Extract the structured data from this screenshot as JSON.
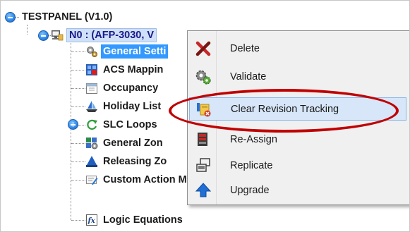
{
  "tree": {
    "root": "TESTPANEL (V1.0)",
    "panel_node": "N0 : (AFP-3030, V",
    "children": [
      "General Setti",
      "ACS Mappin",
      "Occupancy",
      "Holiday List",
      "SLC Loops",
      "General Zon",
      "Releasing Zo",
      "Custom Action Messages",
      "Logic Equations"
    ]
  },
  "context_menu": {
    "items": [
      {
        "label": "Delete",
        "icon": "red-x-icon"
      },
      {
        "label": "Validate",
        "icon": "gear-validate-icon"
      },
      {
        "label": "Clear Revision Tracking",
        "icon": "clear-revision-icon"
      },
      {
        "label": "Re-Assign",
        "icon": "reassign-icon"
      },
      {
        "label": "Replicate",
        "icon": "replicate-icon"
      },
      {
        "label": "Upgrade",
        "icon": "upgrade-arrow-icon"
      }
    ],
    "highlighted_item": "Clear Revision Tracking"
  },
  "colors": {
    "selection": "#3399ff",
    "menu_hover": "#d7e6f8",
    "annotation_oval": "#c00000"
  }
}
